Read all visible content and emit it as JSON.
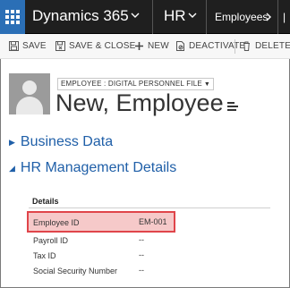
{
  "navbar": {
    "brand": "Dynamics 365",
    "area": "HR",
    "entity": "Employees",
    "overflow": "|",
    "icons": {
      "app_launcher": "waffle-grid-icon",
      "dropdown": "chevron-down-icon"
    }
  },
  "commands": {
    "save": "SAVE",
    "save_close": "SAVE & CLOSE",
    "new": "NEW",
    "deactivate": "DEACTIVATE",
    "delete": "DELETE"
  },
  "header": {
    "form_selector": "EMPLOYEE : DIGITAL PERSONNEL FILE",
    "title": "New, Employee"
  },
  "sections": [
    {
      "label": "Business Data",
      "expanded": false
    },
    {
      "label": "HR Management Details",
      "expanded": true
    }
  ],
  "details": {
    "heading": "Details",
    "fields": [
      {
        "label": "Employee ID",
        "value": "EM-001"
      },
      {
        "label": "Payroll ID",
        "value": "--"
      },
      {
        "label": "Tax ID",
        "value": "--"
      },
      {
        "label": "Social Security Number",
        "value": "--"
      }
    ]
  },
  "colors": {
    "navbar_bg": "#1f1f1f",
    "app_launcher_bg": "#2b6fb6",
    "section_link": "#1f5fa8",
    "highlight_fill": "#f6c9c9",
    "highlight_border": "#e0454a"
  }
}
